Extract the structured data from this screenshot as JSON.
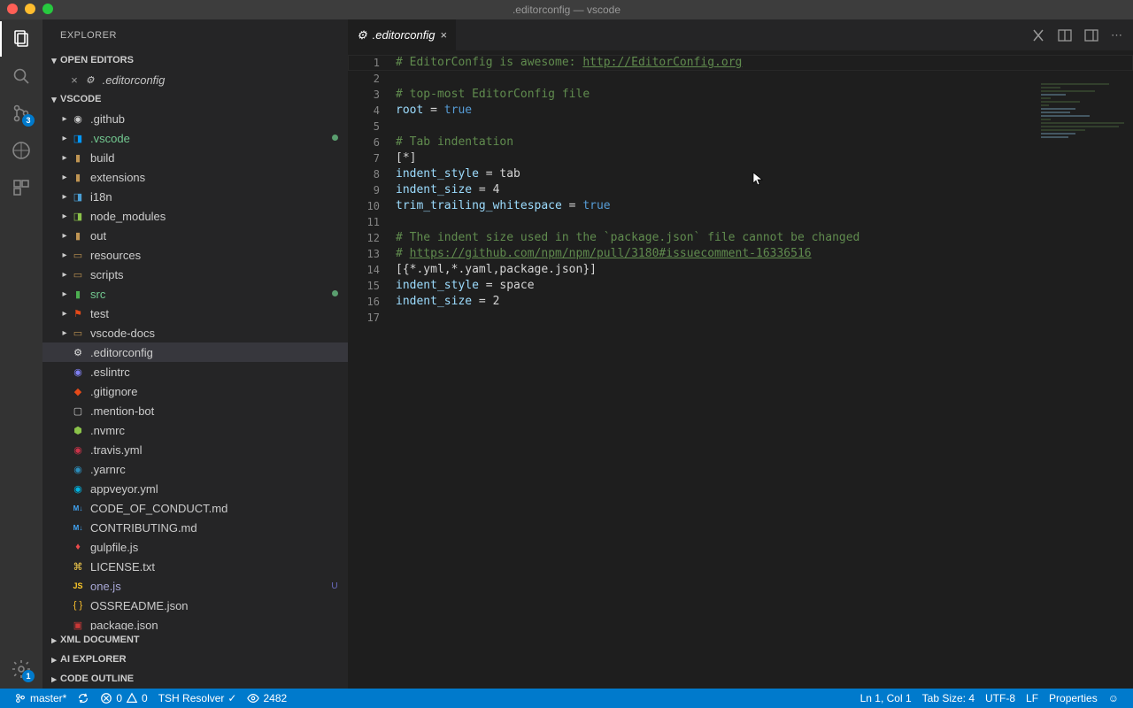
{
  "window": {
    "title": ".editorconfig — vscode"
  },
  "activitybar": {
    "scm_badge": "3",
    "settings_badge": "1"
  },
  "explorer": {
    "title": "EXPLORER",
    "sections": {
      "openEditors": "OPEN EDITORS",
      "workspace": "VSCODE",
      "xml": "XML DOCUMENT",
      "ai": "AI EXPLORER",
      "outline": "CODE OUTLINE"
    },
    "openEditorItems": [
      {
        "name": ".editorconfig",
        "icon": "⚙"
      }
    ],
    "tree": [
      {
        "name": ".github",
        "type": "folder",
        "icon": "github",
        "depth": 1
      },
      {
        "name": ".vscode",
        "type": "folder",
        "icon": "vscode",
        "depth": 1,
        "status": "m"
      },
      {
        "name": "build",
        "type": "folder",
        "icon": "folder",
        "depth": 1
      },
      {
        "name": "extensions",
        "type": "folder",
        "icon": "folder",
        "depth": 1
      },
      {
        "name": "i18n",
        "type": "folder",
        "icon": "i18n",
        "depth": 1
      },
      {
        "name": "node_modules",
        "type": "folder",
        "icon": "nm",
        "depth": 1
      },
      {
        "name": "out",
        "type": "folder",
        "icon": "folder",
        "depth": 1
      },
      {
        "name": "resources",
        "type": "folder",
        "icon": "folder-o",
        "depth": 1
      },
      {
        "name": "scripts",
        "type": "folder",
        "icon": "folder-o",
        "depth": 1
      },
      {
        "name": "src",
        "type": "folder",
        "icon": "src",
        "depth": 1,
        "status": "m"
      },
      {
        "name": "test",
        "type": "folder",
        "icon": "test",
        "depth": 1
      },
      {
        "name": "vscode-docs",
        "type": "folder",
        "icon": "folder-o",
        "depth": 1
      },
      {
        "name": ".editorconfig",
        "type": "file",
        "icon": "gear",
        "depth": 1,
        "selected": true
      },
      {
        "name": ".eslintrc",
        "type": "file",
        "icon": "eslint",
        "depth": 1
      },
      {
        "name": ".gitignore",
        "type": "file",
        "icon": "git",
        "depth": 1
      },
      {
        "name": ".mention-bot",
        "type": "file",
        "icon": "file",
        "depth": 1
      },
      {
        "name": ".nvmrc",
        "type": "file",
        "icon": "nvm",
        "depth": 1
      },
      {
        "name": ".travis.yml",
        "type": "file",
        "icon": "travis",
        "depth": 1
      },
      {
        "name": ".yarnrc",
        "type": "file",
        "icon": "yarn",
        "depth": 1
      },
      {
        "name": "appveyor.yml",
        "type": "file",
        "icon": "appveyor",
        "depth": 1
      },
      {
        "name": "CODE_OF_CONDUCT.md",
        "type": "file",
        "icon": "md",
        "depth": 1
      },
      {
        "name": "CONTRIBUTING.md",
        "type": "file",
        "icon": "md",
        "depth": 1
      },
      {
        "name": "gulpfile.js",
        "type": "file",
        "icon": "gulp",
        "depth": 1
      },
      {
        "name": "LICENSE.txt",
        "type": "file",
        "icon": "license",
        "depth": 1
      },
      {
        "name": "one.js",
        "type": "file",
        "icon": "js",
        "depth": 1,
        "status": "u"
      },
      {
        "name": "OSSREADME.json",
        "type": "file",
        "icon": "json",
        "depth": 1
      },
      {
        "name": "package.json",
        "type": "file",
        "icon": "npm",
        "depth": 1
      }
    ]
  },
  "editor": {
    "tab": {
      "name": ".editorconfig"
    },
    "lines": 17,
    "code": [
      {
        "n": 1,
        "t": "comment",
        "text": "# EditorConfig is awesome: ",
        "link": "http://EditorConfig.org"
      },
      {
        "n": 2,
        "t": "blank"
      },
      {
        "n": 3,
        "t": "comment",
        "text": "# top-most EditorConfig file"
      },
      {
        "n": 4,
        "t": "kv",
        "key": "root",
        "val": "true"
      },
      {
        "n": 5,
        "t": "blank"
      },
      {
        "n": 6,
        "t": "comment",
        "text": "# Tab indentation"
      },
      {
        "n": 7,
        "t": "plain",
        "text": "[*]"
      },
      {
        "n": 8,
        "t": "kv",
        "key": "indent_style",
        "val": "tab"
      },
      {
        "n": 9,
        "t": "kv",
        "key": "indent_size",
        "val": "4"
      },
      {
        "n": 10,
        "t": "kv",
        "key": "trim_trailing_whitespace",
        "val": "true"
      },
      {
        "n": 11,
        "t": "blank"
      },
      {
        "n": 12,
        "t": "comment",
        "text": "# The indent size used in the `package.json` file cannot be changed"
      },
      {
        "n": 13,
        "t": "commentlink",
        "text": "# ",
        "link": "https://github.com/npm/npm/pull/3180#issuecomment-16336516"
      },
      {
        "n": 14,
        "t": "plain",
        "text": "[{*.yml,*.yaml,package.json}]"
      },
      {
        "n": 15,
        "t": "kv",
        "key": "indent_style",
        "val": "space"
      },
      {
        "n": 16,
        "t": "kv",
        "key": "indent_size",
        "val": "2"
      },
      {
        "n": 17,
        "t": "blank"
      }
    ]
  },
  "statusbar": {
    "branch": "master*",
    "errors": "0",
    "warnings": "0",
    "resolver": "TSH Resolver",
    "views": "2482",
    "position": "Ln 1, Col 1",
    "tabSize": "Tab Size: 4",
    "encoding": "UTF-8",
    "eol": "LF",
    "language": "Properties"
  }
}
